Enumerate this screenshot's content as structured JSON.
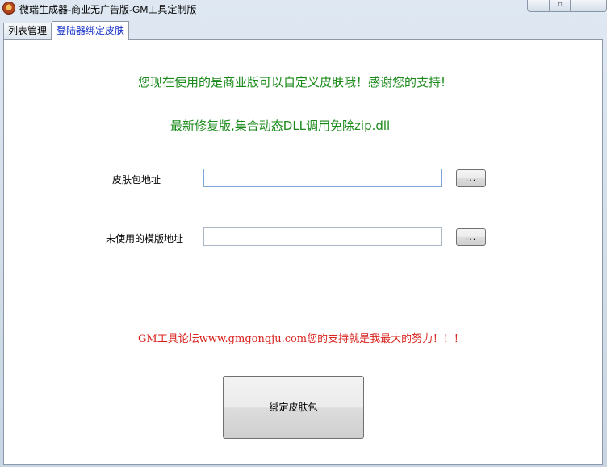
{
  "window": {
    "title": "微端生成器-商业无广告版-GM工具定制版",
    "controls": {
      "minimize": "",
      "maximize": "▫",
      "close": ""
    }
  },
  "tabs": [
    {
      "label": "列表管理",
      "active": false
    },
    {
      "label": "登陆器绑定皮肤",
      "active": true
    }
  ],
  "panel": {
    "message_line1": "您现在使用的是商业版可以自定义皮肤哦！感谢您的支持!",
    "message_line2": "最新修复版,集合动态DLL调用免除zip.dll",
    "skin_path": {
      "label": "皮肤包地址",
      "value": "",
      "browse_label": "..."
    },
    "template_path": {
      "label": "未使用的模版地址",
      "value": "",
      "browse_label": "..."
    },
    "forum_message": "GM工具论坛www.gmgongju.com您的支持就是我最大的努力！！！",
    "bind_button": "绑定皮肤包"
  },
  "colors": {
    "green_text": "#1a8a1a",
    "red_text": "#d9231e",
    "active_tab_text": "#1530c8"
  }
}
